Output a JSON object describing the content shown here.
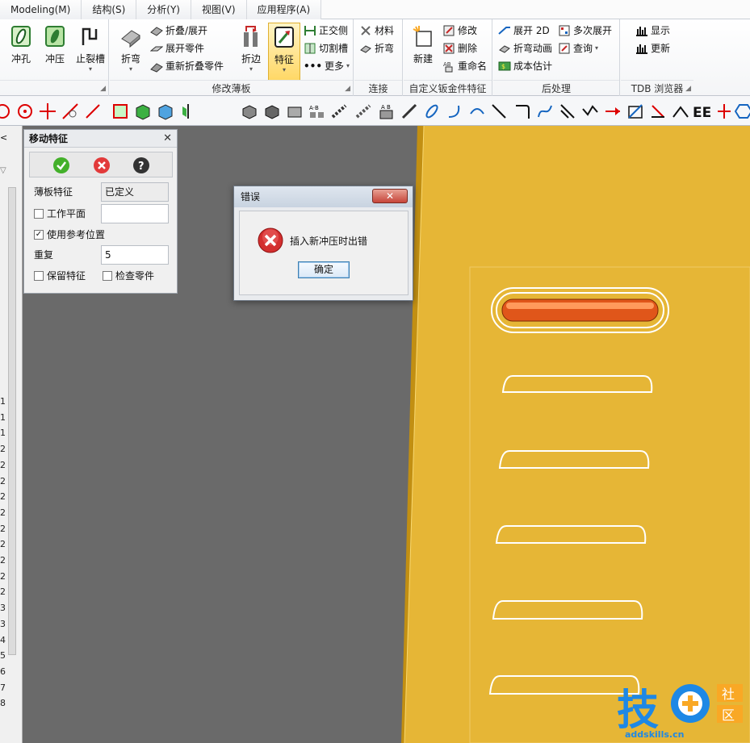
{
  "menu": {
    "tabs": [
      "Modeling(M)",
      "结构(S)",
      "分析(Y)",
      "视图(V)",
      "应用程序(A)"
    ]
  },
  "ribbon": {
    "groups": [
      {
        "title": ""
      },
      {
        "title": "修改薄板"
      },
      {
        "title": "连接"
      },
      {
        "title": "自定义钣金件特征"
      },
      {
        "title": "后处理"
      },
      {
        "title": "TDB 浏览器"
      }
    ],
    "buttons": {
      "punch_hole": "冲孔",
      "stamp": "冲压",
      "relief_slot": "止裂槽",
      "bend": "折弯",
      "fold_unfold": "折叠/展开",
      "unfold_part": "展开零件",
      "refold_part": "重新折叠零件",
      "flange": "折边",
      "feature": "特征",
      "ortho_side": "正交侧",
      "cut_slot": "切割槽",
      "more": "更多",
      "material": "材料",
      "bend_join": "折弯",
      "new": "新建",
      "modify": "修改",
      "delete": "删除",
      "rename": "重命名",
      "unfold_2d": "展开 2D",
      "multi_unfold": "多次展开",
      "bend_animation": "折弯动画",
      "query": "查询",
      "cost_estimate": "成本估计",
      "show": "显示",
      "update": "更新"
    }
  },
  "panel": {
    "title": "移动特征",
    "sheet_feature_label": "薄板特征",
    "sheet_feature_value": "已定义",
    "work_plane_label": "工作平面",
    "use_ref_pos_label": "使用参考位置",
    "use_ref_pos_checked": true,
    "repeat_label": "重复",
    "repeat_value": "5",
    "keep_feature_label": "保留特征",
    "check_part_label": "检查零件"
  },
  "dialog": {
    "title": "错误",
    "message": "插入新冲压时出错",
    "ok_label": "确定"
  },
  "left_strip": {
    "numbers": [
      "1",
      "1",
      "1",
      "2",
      "2",
      "2",
      "2",
      "2",
      "2",
      "2",
      "2",
      "2",
      "2",
      "3",
      "3",
      "4",
      "5",
      "6",
      "7",
      "8"
    ]
  },
  "watermark": {
    "brand": "技",
    "tag1": "社",
    "tag2": "区",
    "url": "addskills.cn"
  },
  "colors": {
    "part": "#e8b83a",
    "slot_highlight": "#e0561a",
    "viewport": "#6a6a6a"
  }
}
